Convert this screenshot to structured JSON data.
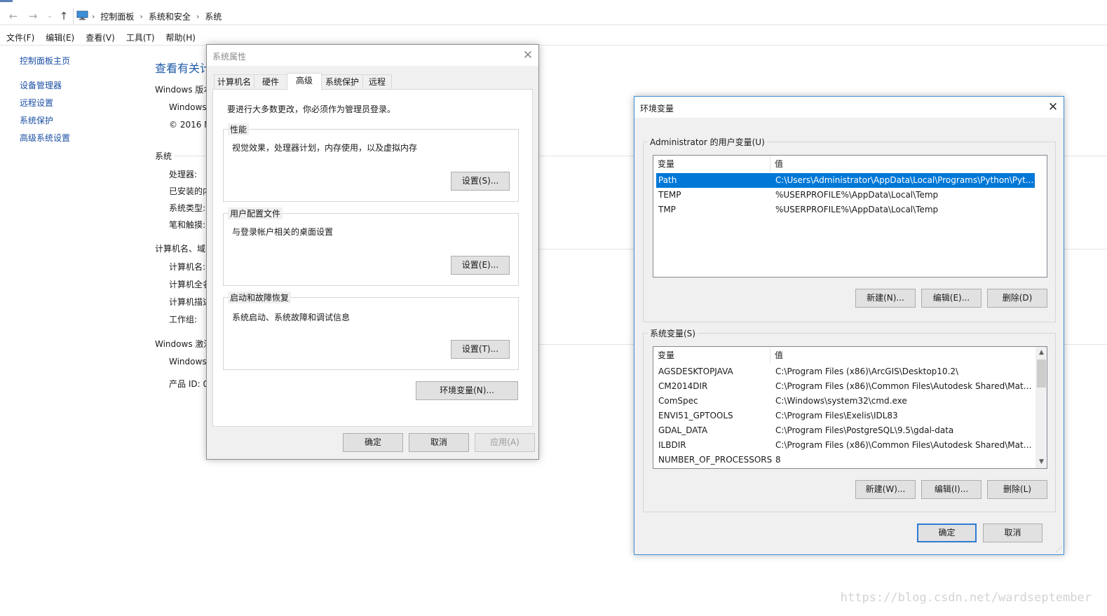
{
  "breadcrumbs": [
    "控制面板",
    "系统和安全",
    "系统"
  ],
  "menubar": [
    "文件(F)",
    "编辑(E)",
    "查看(V)",
    "工具(T)",
    "帮助(H)"
  ],
  "left_nav": {
    "home": "控制面板主页",
    "items": [
      "设备管理器",
      "远程设置",
      "系统保护",
      "高级系统设置"
    ]
  },
  "main": {
    "title": "查看有关计",
    "windows_edition_heading": "Windows 版本",
    "edition_line1": "Windows",
    "edition_line2": "© 2016 M",
    "system_heading": "系统",
    "system_rows": [
      "处理器:",
      "已安装的内",
      "系统类型:",
      "笔和触摸:"
    ],
    "computer_heading": "计算机名、域",
    "computer_rows": [
      "计算机名:",
      "计算机全名",
      "计算机描述",
      "工作组:"
    ],
    "activation_heading": "Windows 激活",
    "activation_line": "Windows",
    "product_id": "产品 ID: 0"
  },
  "sysprops": {
    "title": "系统属性",
    "tabs": [
      "计算机名",
      "硬件",
      "高级",
      "系统保护",
      "远程"
    ],
    "active_tab": "高级",
    "admin_note": "要进行大多数更改，你必须作为管理员登录。",
    "groups": [
      {
        "title": "性能",
        "desc": "视觉效果，处理器计划，内存使用，以及虚拟内存",
        "button": "设置(S)..."
      },
      {
        "title": "用户配置文件",
        "desc": "与登录帐户相关的桌面设置",
        "button": "设置(E)..."
      },
      {
        "title": "启动和故障恢复",
        "desc": "系统启动、系统故障和调试信息",
        "button": "设置(T)..."
      }
    ],
    "env_button": "环境变量(N)...",
    "ok": "确定",
    "cancel": "取消",
    "apply": "应用(A)"
  },
  "envvars": {
    "title": "环境变量",
    "user_group_title": "Administrator 的用户变量(U)",
    "col_var": "变量",
    "col_val": "值",
    "user_vars": [
      {
        "name": "Path",
        "value": "C:\\Users\\Administrator\\AppData\\Local\\Programs\\Python\\Pyt...",
        "selected": true
      },
      {
        "name": "TEMP",
        "value": "%USERPROFILE%\\AppData\\Local\\Temp",
        "selected": false
      },
      {
        "name": "TMP",
        "value": "%USERPROFILE%\\AppData\\Local\\Temp",
        "selected": false
      }
    ],
    "user_buttons": [
      "新建(N)...",
      "编辑(E)...",
      "删除(D)"
    ],
    "sys_group_title": "系统变量(S)",
    "sys_vars": [
      {
        "name": "AGSDESKTOPJAVA",
        "value": "C:\\Program Files (x86)\\ArcGIS\\Desktop10.2\\"
      },
      {
        "name": "CM2014DIR",
        "value": "C:\\Program Files (x86)\\Common Files\\Autodesk Shared\\Mate..."
      },
      {
        "name": "ComSpec",
        "value": "C:\\Windows\\system32\\cmd.exe"
      },
      {
        "name": "ENVI51_GPTOOLS",
        "value": "C:\\Program Files\\Exelis\\IDL83"
      },
      {
        "name": "GDAL_DATA",
        "value": "C:\\Program Files\\PostgreSQL\\9.5\\gdal-data"
      },
      {
        "name": "ILBDIR",
        "value": "C:\\Program Files (x86)\\Common Files\\Autodesk Shared\\Mate..."
      },
      {
        "name": "NUMBER_OF_PROCESSORS",
        "value": "8"
      }
    ],
    "sys_buttons": [
      "新建(W)...",
      "编辑(I)...",
      "删除(L)"
    ],
    "ok": "确定",
    "cancel": "取消"
  },
  "watermark": "https://blog.csdn.net/wardseptember",
  "colors": {
    "selection": "#0078d7",
    "link": "#1a4fa3",
    "default_button_border": "#2f7bd2"
  }
}
